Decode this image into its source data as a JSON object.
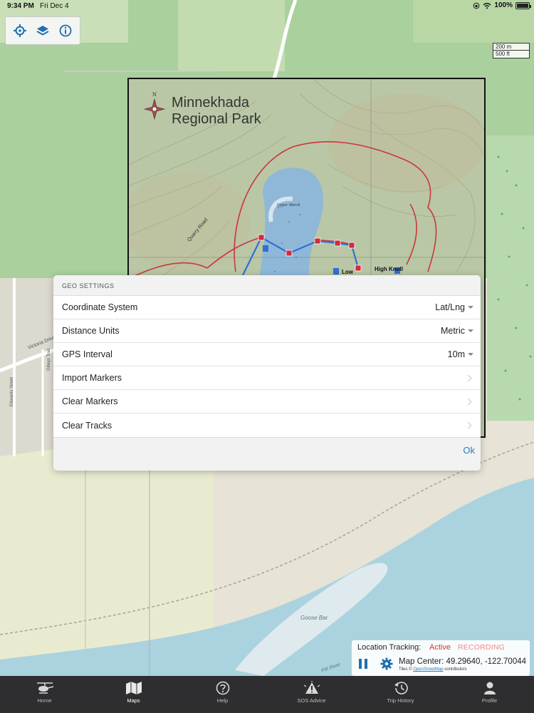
{
  "status_bar": {
    "time": "9:34 PM",
    "date": "Fri Dec 4",
    "battery": "100%"
  },
  "map": {
    "scale_metric": "200 m",
    "scale_imperial": "500 ft",
    "labels": {
      "goose_bar": "Goose Bar",
      "victoria_drive": "Victoria Drive",
      "edwards_street": "Edwards Street",
      "gilleys_trail": "Gilleys Trail",
      "pitt_river": "Pitt River",
      "quarry_road": "Quarry Road",
      "upper_marsh": "Upper Marsh",
      "low": "Low",
      "high_knoll": "High Knoll"
    },
    "park_title_line1": "Minnekhada",
    "park_title_line2": "Regional Park"
  },
  "dialog": {
    "header": "GEO SETTINGS",
    "rows": [
      {
        "label": "Coordinate System",
        "value": "Lat/Lng",
        "kind": "select"
      },
      {
        "label": "Distance Units",
        "value": "Metric",
        "kind": "select"
      },
      {
        "label": "GPS Interval",
        "value": "10m",
        "kind": "select"
      },
      {
        "label": "Import Markers",
        "value": "",
        "kind": "nav"
      },
      {
        "label": "Clear Markers",
        "value": "",
        "kind": "nav"
      },
      {
        "label": "Clear Tracks",
        "value": "",
        "kind": "nav"
      }
    ],
    "ok_label": "Ok"
  },
  "tracking": {
    "label": "Location Tracking:",
    "status": "Active",
    "recording": "RECORDING",
    "map_center": "Map Center: 49.29640, -122.70044",
    "tiles_prefix": "Tiles ©",
    "tiles_link": "OpenStreetMap",
    "tiles_suffix": "contributors"
  },
  "tabbar": {
    "tabs": [
      {
        "label": "Home",
        "icon": "helicopter-icon"
      },
      {
        "label": "Maps",
        "icon": "map-icon",
        "selected": true
      },
      {
        "label": "Help",
        "icon": "help-icon"
      },
      {
        "label": "SOS Advice",
        "icon": "sos-icon"
      },
      {
        "label": "Trip History",
        "icon": "history-icon"
      },
      {
        "label": "Profile",
        "icon": "profile-icon"
      }
    ]
  }
}
